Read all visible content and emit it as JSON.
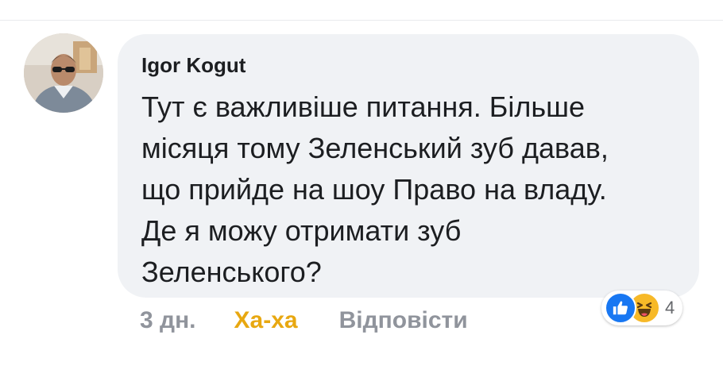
{
  "comment": {
    "author": "Igor Kogut",
    "text": "Тут є важливіше питання. Більше\nмісяця тому Зеленський зуб давав,\nщо прийде на шоу Право на владу.\nДе я можу отримати зуб\nЗеленського?"
  },
  "actions": {
    "time": "3 дн.",
    "reaction_label": "Ха-ха",
    "reply_label": "Відповісти"
  },
  "reactions": {
    "icons": [
      "like-icon",
      "haha-icon"
    ],
    "count": "4"
  },
  "colors": {
    "bubble": "#f0f2f5",
    "haha_accent": "#e8a811",
    "like_blue": "#1877f2",
    "muted": "#90949c"
  }
}
